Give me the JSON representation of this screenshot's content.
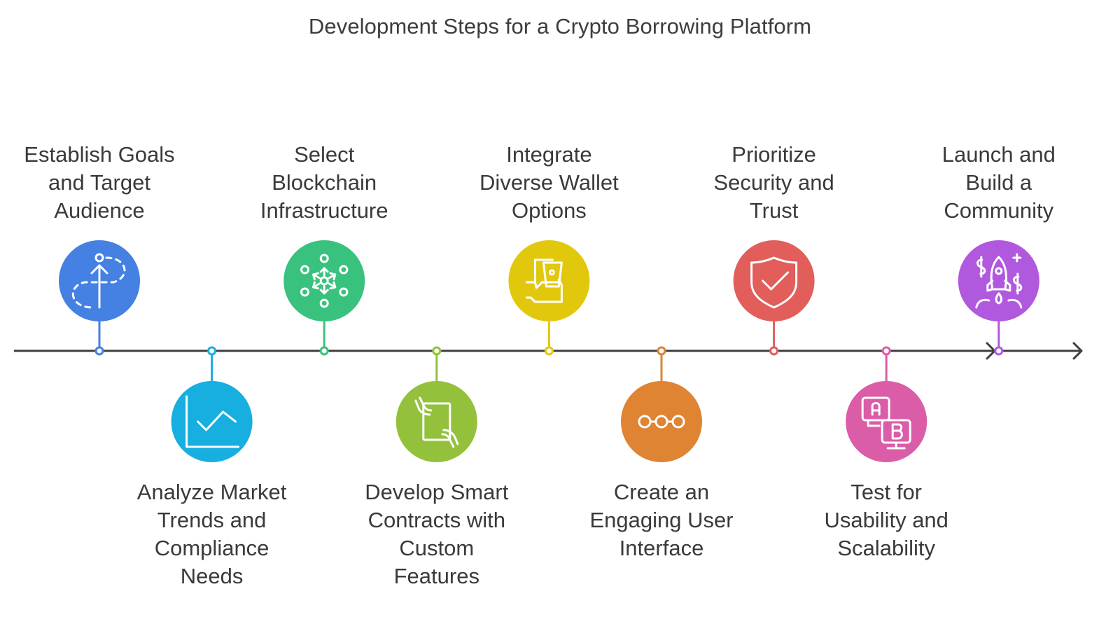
{
  "title": "Development Steps for a Crypto Borrowing Platform",
  "timeline": {
    "line_color": "#3f3f3f",
    "arrows": [
      "chevron-right-icon",
      "arrow-right-icon"
    ]
  },
  "steps": [
    {
      "label": "Establish Goals and Target Audience",
      "lines": [
        "Establish Goals",
        "and Target",
        "Audience"
      ],
      "position": "above",
      "color": "#4580e3",
      "icon": "goal-path-icon"
    },
    {
      "label": "Analyze Market Trends and Compliance Needs",
      "lines": [
        "Analyze Market",
        "Trends and",
        "Compliance",
        "Needs"
      ],
      "position": "below",
      "color": "#17aee0",
      "icon": "line-chart-icon"
    },
    {
      "label": "Select Blockchain Infrastructure",
      "lines": [
        "Select",
        "Blockchain",
        "Infrastructure"
      ],
      "position": "above",
      "color": "#39c27e",
      "icon": "network-nodes-icon"
    },
    {
      "label": "Develop Smart Contracts with Custom Features",
      "lines": [
        "Develop Smart",
        "Contracts with",
        "Custom",
        "Features"
      ],
      "position": "below",
      "color": "#93c13b",
      "icon": "hands-tablet-icon"
    },
    {
      "label": "Integrate Diverse Wallet Options",
      "lines": [
        "Integrate",
        "Diverse Wallet",
        "Options"
      ],
      "position": "above",
      "color": "#e2c80d",
      "icon": "hand-money-icon"
    },
    {
      "label": "Create an Engaging User Interface",
      "lines": [
        "Create an",
        "Engaging User",
        "Interface"
      ],
      "position": "below",
      "color": "#de8432",
      "icon": "connected-dots-icon"
    },
    {
      "label": "Prioritize Security and Trust",
      "lines": [
        "Prioritize",
        "Security and",
        "Trust"
      ],
      "position": "above",
      "color": "#e25e5b",
      "icon": "shield-check-icon"
    },
    {
      "label": "Test for Usability and Scalability",
      "lines": [
        "Test for",
        "Usability and",
        "Scalability"
      ],
      "position": "below",
      "color": "#db5ca7",
      "icon": "ab-test-icon"
    },
    {
      "label": "Launch and Build a Community",
      "lines": [
        "Launch and",
        "Build a",
        "Community"
      ],
      "position": "above",
      "color": "#b159de",
      "icon": "rocket-launch-icon"
    }
  ]
}
